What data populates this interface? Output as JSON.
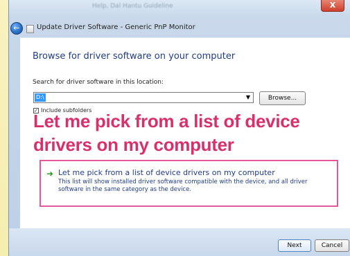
{
  "window": {
    "blurred_title": "Help, Dal Hantu Guideline",
    "close_label": "X",
    "title": "Update Driver Software - Generic PnP Monitor"
  },
  "main": {
    "heading": "Browse for driver software on your computer",
    "search_label": "Search for driver software in this location:",
    "path_value": "D:\\",
    "browse_label": "Browse...",
    "include_subfolders_label": "Include subfolders",
    "include_subfolders_checked": true,
    "overlay_text": "Let me pick from a list of device\ndrivers on my computer",
    "pick_option": {
      "title": "Let me pick from a list of device drivers on my computer",
      "description": "This list will show installed driver software compatible with the device, and all driver software in the same category as the device."
    }
  },
  "footer": {
    "next_label": "Next",
    "cancel_label": "Cancel"
  },
  "colors": {
    "overlay_text": "#d9306b",
    "overlay_border": "#e5569a",
    "link_blue": "#1e3c8a"
  },
  "icons": {
    "back": "back-arrow-icon",
    "window": "device-icon",
    "dropdown": "chevron-down-icon",
    "pick": "green-arrow-icon",
    "checkbox": "checkbox-icon"
  }
}
